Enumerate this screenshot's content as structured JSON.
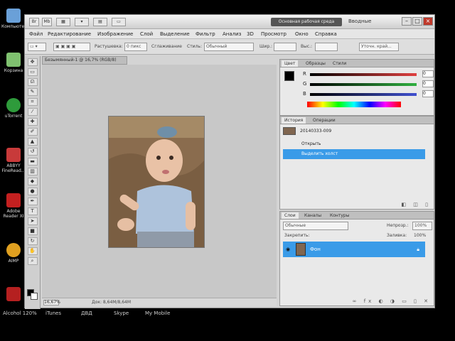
{
  "desktop": {
    "icons": [
      {
        "label": "Компьютер",
        "color": "#6aa0d8"
      },
      {
        "label": "Корзина",
        "color": "#7fc16f"
      },
      {
        "label": "uTorrent",
        "color": "#2e9b3b"
      },
      {
        "label": "ABBYY FineRead...",
        "color": "#c83a3a"
      },
      {
        "label": "Adobe Reader XI",
        "color": "#c42020"
      },
      {
        "label": "AIMP",
        "color": "#e0a020"
      },
      {
        "label": "Alcohol 120%",
        "color": "#b52020"
      }
    ],
    "taskbar_labels": [
      "Alcohol 120%",
      "iTunes",
      "ДВД",
      "Skype",
      "My Mobile"
    ]
  },
  "app": {
    "title_buttons": [
      "Br",
      "Mb"
    ],
    "workspace_button": "Основная рабочая среда",
    "workspace_label": "Вводные",
    "window_controls": {
      "minimize": "–",
      "maximize": "□",
      "close": "×"
    },
    "menu": [
      "Файл",
      "Редактирование",
      "Изображение",
      "Слой",
      "Выделение",
      "Фильтр",
      "Анализ",
      "3D",
      "Просмотр",
      "Окно",
      "Справка"
    ],
    "options": {
      "feather_label": "Растушевка:",
      "feather_value": "0 пикс",
      "antialias_label": "Сглаживание",
      "style_label": "Стиль:",
      "style_value": "Обычный",
      "width_label": "Шир.:",
      "height_label": "Выс.:",
      "refine_label": "Уточн. край..."
    },
    "document": {
      "tab_title": "Безымянный-1 @ 16,7% (RGB/8)",
      "zoom": "16,67%",
      "status": "Док: 8,64M/8,64M"
    }
  },
  "panels": {
    "color": {
      "tabs": [
        "Цвет",
        "Образцы",
        "Стили"
      ],
      "channels": [
        {
          "name": "R",
          "value": "0",
          "color": "#e04040"
        },
        {
          "name": "G",
          "value": "0",
          "color": "#30b040"
        },
        {
          "name": "B",
          "value": "0",
          "color": "#4050d0"
        }
      ]
    },
    "history": {
      "tabs": [
        "История",
        "Операции"
      ],
      "items": [
        "20140333-009",
        "Открыть",
        "Выделить холст"
      ]
    },
    "layers": {
      "tabs": [
        "Слои",
        "Каналы",
        "Контуры"
      ],
      "blend_mode": "Обычные",
      "opacity_label": "Непрозр.:",
      "opacity_value": "100%",
      "lock_label": "Закрепить:",
      "fill_label": "Заливка:",
      "fill_value": "100%",
      "layer_name": "Фон"
    }
  }
}
